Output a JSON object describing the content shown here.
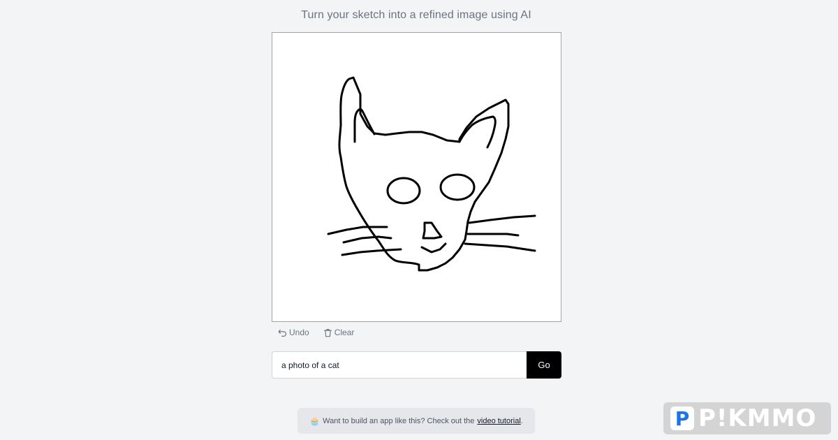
{
  "header": {
    "tagline": "Turn your sketch into a refined image using AI"
  },
  "canvas": {
    "stroke_color": "#000000",
    "background": "#ffffff"
  },
  "toolbar": {
    "undo_label": "Undo",
    "undo_icon": "undo-arrow-icon",
    "clear_label": "Clear",
    "clear_icon": "trash-icon"
  },
  "prompt": {
    "value": "a photo of a cat",
    "submit_label": "Go"
  },
  "promo": {
    "emoji": "🧁",
    "text_before": "Want to build an app like this? Check out the",
    "link_text": "video tutorial",
    "text_after": "."
  },
  "watermark": {
    "badge": "P",
    "text": "P!KMMO"
  }
}
